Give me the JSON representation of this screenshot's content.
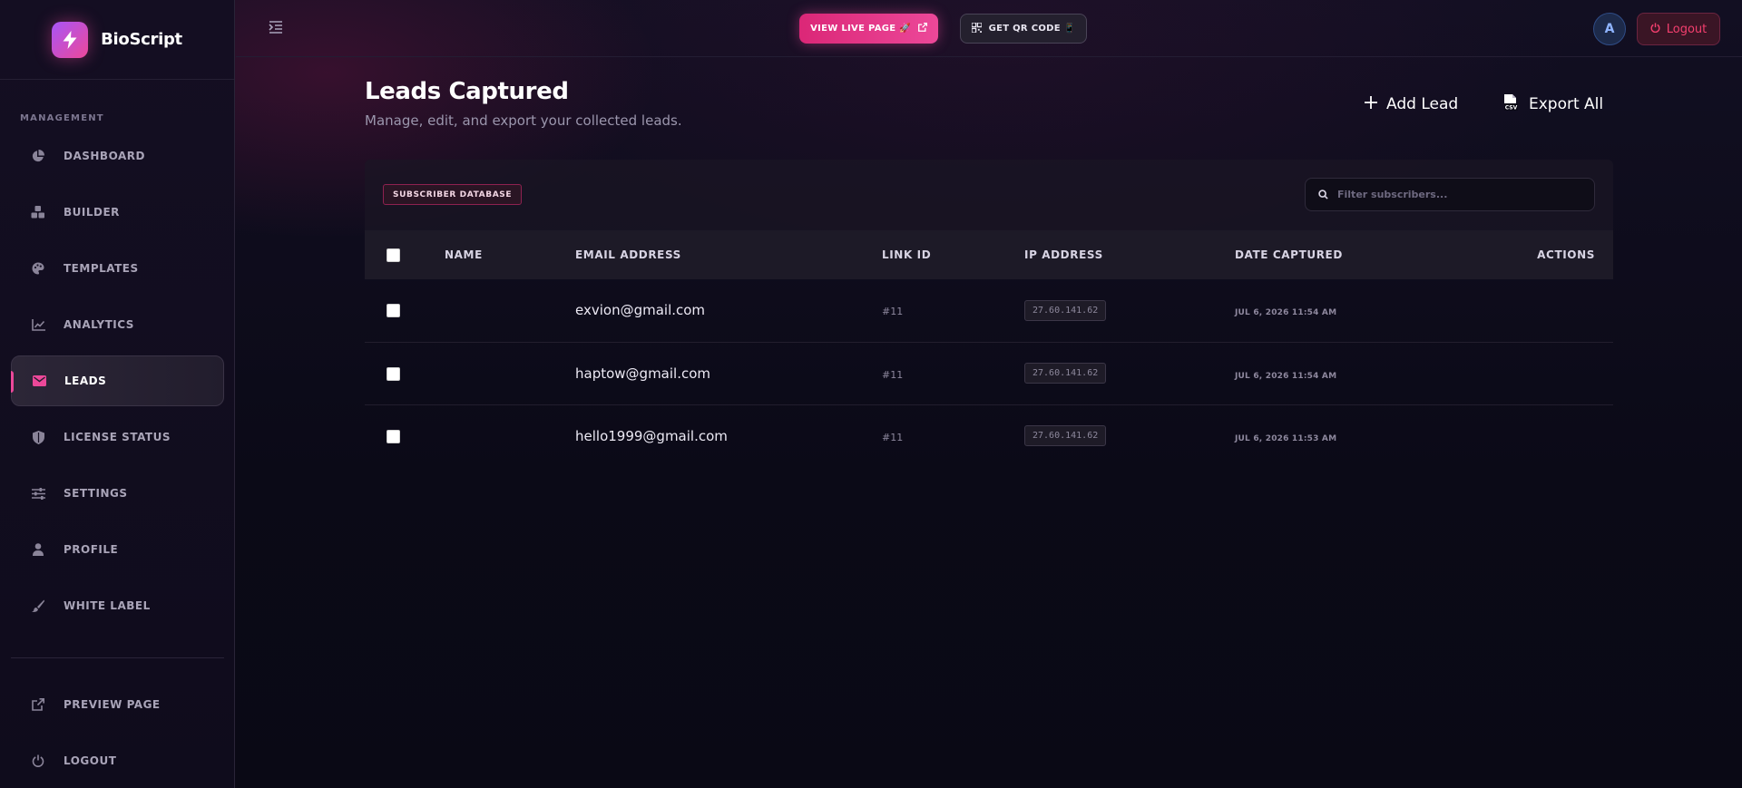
{
  "brand": {
    "name": "BioScript",
    "logo_icon": "bolt-icon",
    "accent": "#ec4899"
  },
  "sidebar": {
    "section_label": "MANAGEMENT",
    "items": [
      {
        "label": "DASHBOARD",
        "icon": "pie-chart-icon",
        "active": false
      },
      {
        "label": "BUILDER",
        "icon": "cubes-icon",
        "active": false
      },
      {
        "label": "TEMPLATES",
        "icon": "palette-icon",
        "active": false
      },
      {
        "label": "ANALYTICS",
        "icon": "line-chart-icon",
        "active": false
      },
      {
        "label": "LEADS",
        "icon": "envelope-icon",
        "active": true
      },
      {
        "label": "LICENSE STATUS",
        "icon": "shield-icon",
        "active": false
      },
      {
        "label": "SETTINGS",
        "icon": "sliders-icon",
        "active": false
      },
      {
        "label": "PROFILE",
        "icon": "user-icon",
        "active": false
      },
      {
        "label": "WHITE LABEL",
        "icon": "brush-icon",
        "active": false
      }
    ],
    "bottom_items": [
      {
        "label": "PREVIEW PAGE",
        "icon": "external-link-icon"
      },
      {
        "label": "LOGOUT",
        "icon": "power-icon"
      }
    ]
  },
  "topbar": {
    "live_button": "VIEW LIVE PAGE 🚀",
    "qr_button": "GET QR CODE 📱",
    "avatar_initial": "A",
    "logout_label": "Logout"
  },
  "main": {
    "title": "Leads Captured",
    "subtitle": "Manage, edit, and export your collected leads.",
    "add_lead_label": "Add Lead",
    "export_label": "Export All",
    "badge": "SUBSCRIBER DATABASE",
    "filter_placeholder": "Filter subscribers..."
  },
  "table": {
    "columns": [
      "NAME",
      "EMAIL ADDRESS",
      "LINK ID",
      "IP ADDRESS",
      "DATE CAPTURED",
      "ACTIONS"
    ],
    "rows": [
      {
        "name": "",
        "email": "exvion@gmail.com",
        "link_id": "#11",
        "ip": "27.60.141.62",
        "date": "JUL 6, 2026 11:54 AM"
      },
      {
        "name": "",
        "email": "haptow@gmail.com",
        "link_id": "#11",
        "ip": "27.60.141.62",
        "date": "JUL 6, 2026 11:54 AM"
      },
      {
        "name": "",
        "email": "hello1999@gmail.com",
        "link_id": "#11",
        "ip": "27.60.141.62",
        "date": "JUL 6, 2026 11:53 AM"
      }
    ]
  }
}
